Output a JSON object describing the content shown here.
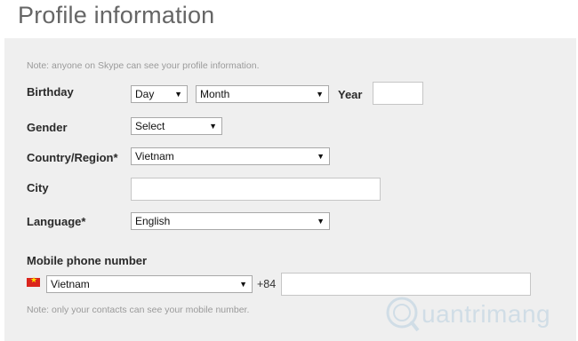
{
  "page": {
    "title": "Profile information"
  },
  "notes": {
    "profile": "Note: anyone on Skype can see your profile information.",
    "mobile": "Note: only your contacts can see your mobile number."
  },
  "birthday": {
    "label": "Birthday",
    "day": "Day",
    "month": "Month",
    "year_label": "Year",
    "year_value": ""
  },
  "gender": {
    "label": "Gender",
    "value": "Select"
  },
  "country": {
    "label": "Country/Region*",
    "value": "Vietnam"
  },
  "city": {
    "label": "City",
    "value": ""
  },
  "language": {
    "label": "Language*",
    "value": "English"
  },
  "mobile": {
    "label": "Mobile phone number",
    "country_value": "Vietnam",
    "prefix": "+84",
    "number": ""
  },
  "icons": {
    "flag": "vietnam-flag-icon",
    "dropdown": "chevron-down-icon",
    "watermark": "quantrimang-logo"
  },
  "watermark": {
    "text": "uantrimang"
  },
  "colors": {
    "panel": "#efefef",
    "title": "#666666",
    "flag_red": "#da251d",
    "flag_star": "#ffdd00"
  }
}
